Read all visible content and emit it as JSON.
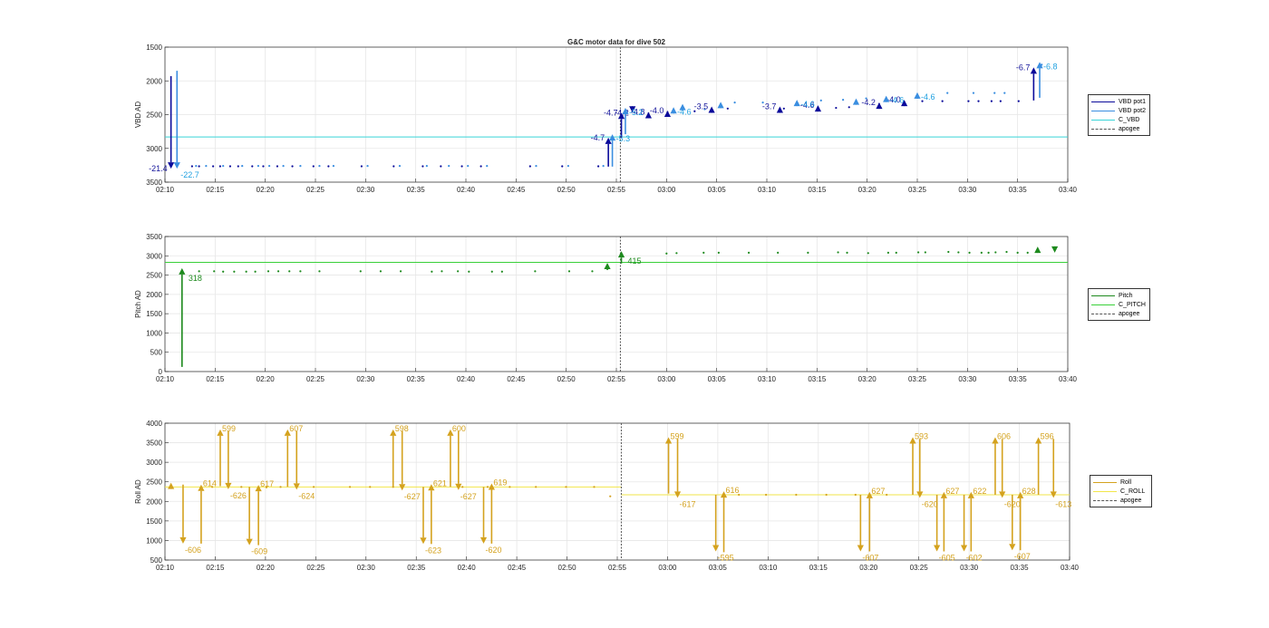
{
  "title": "G&C motor data for dive 502",
  "colors": {
    "vbd_pot1": "#0a0a9a",
    "vbd_pot2": "#3a8ee0",
    "c_vbd": "#39d4d8",
    "vbd_label1": "#14149a",
    "vbd_label2": "#1fa0e0",
    "pitch": "#1e8a1e",
    "c_pitch": "#3ad03a",
    "roll": "#d4a21e",
    "c_roll": "#f2e64a",
    "apogee": "#555555",
    "grid": "#e6e6e6",
    "axis": "#262626"
  },
  "chart_data": [
    {
      "type": "scatter",
      "title": "G&C motor data for dive 502",
      "ylabel": "VBD AD",
      "x_ticks": [
        "02:10",
        "02:15",
        "02:20",
        "02:25",
        "02:30",
        "02:35",
        "02:40",
        "02:45",
        "02:50",
        "02:55",
        "03:00",
        "03:05",
        "03:10",
        "03:15",
        "03:20",
        "03:25",
        "03:30",
        "03:35",
        "03:40"
      ],
      "xlim_minutes": [
        130,
        220
      ],
      "ylim": [
        1500,
        3500
      ],
      "y_reversed": true,
      "y_ticks": [
        "1500",
        "2000",
        "2500",
        "3000",
        "3500"
      ],
      "grid": true,
      "legend": [
        "VBD pot1",
        "VBD pot2",
        "C_VBD",
        "apogee"
      ],
      "legend_position": "right",
      "c_value": 2830,
      "apogee_minutes": 175.4,
      "pot1_points": [
        [
          132.7,
          3265
        ],
        [
          133.4,
          3265
        ],
        [
          134.8,
          3265
        ],
        [
          135.5,
          3265
        ],
        [
          136.5,
          3265
        ],
        [
          137.3,
          3265
        ],
        [
          138.7,
          3265
        ],
        [
          139.8,
          3265
        ],
        [
          141.2,
          3265
        ],
        [
          142.7,
          3265
        ],
        [
          144.8,
          3265
        ],
        [
          146.3,
          3265
        ],
        [
          149.6,
          3265
        ],
        [
          152.8,
          3265
        ],
        [
          155.7,
          3265
        ],
        [
          157.5,
          3265
        ],
        [
          159.6,
          3265
        ],
        [
          161.5,
          3265
        ],
        [
          166.4,
          3265
        ],
        [
          169.6,
          3265
        ],
        [
          173.2,
          3265
        ],
        [
          182.8,
          2450
        ],
        [
          186.1,
          2410
        ],
        [
          191.7,
          2410
        ],
        [
          196.9,
          2400
        ],
        [
          198.2,
          2390
        ],
        [
          205.5,
          2300
        ],
        [
          207.5,
          2300
        ],
        [
          210.1,
          2300
        ],
        [
          211.1,
          2300
        ],
        [
          212.4,
          2300
        ],
        [
          213.3,
          2300
        ],
        [
          215.1,
          2300
        ]
      ],
      "pot2_points": [
        [
          133.1,
          3260
        ],
        [
          134.1,
          3260
        ],
        [
          135.8,
          3260
        ],
        [
          137.7,
          3260
        ],
        [
          139.3,
          3260
        ],
        [
          140.4,
          3260
        ],
        [
          141.8,
          3260
        ],
        [
          143.5,
          3260
        ],
        [
          145.4,
          3260
        ],
        [
          146.8,
          3260
        ],
        [
          150.2,
          3260
        ],
        [
          153.4,
          3260
        ],
        [
          156.1,
          3260
        ],
        [
          158.3,
          3260
        ],
        [
          160.2,
          3260
        ],
        [
          162.1,
          3260
        ],
        [
          167,
          3260
        ],
        [
          170.2,
          3260
        ],
        [
          173.7,
          3260
        ],
        [
          183.8,
          2420
        ],
        [
          186.8,
          2320
        ],
        [
          189.6,
          2320
        ],
        [
          195.4,
          2290
        ],
        [
          197.6,
          2280
        ],
        [
          199.9,
          2260
        ],
        [
          208,
          2180
        ],
        [
          210.6,
          2180
        ],
        [
          212.7,
          2180
        ],
        [
          213.7,
          2180
        ],
        [
          217.4,
          1760
        ]
      ],
      "pot1_moves": [
        {
          "t": 130.6,
          "y0": 1930,
          "y1": 3300,
          "label": "-21.4"
        },
        {
          "t": 174.2,
          "y0": 3270,
          "y1": 2840,
          "label": "-4.7"
        },
        {
          "t": 175.5,
          "y0": 2840,
          "y1": 2470,
          "label": "-4.7"
        },
        {
          "t": 176.6,
          "y0": 2470,
          "y1": 2470,
          "label": "-4.2"
        },
        {
          "t": 178.2,
          "y0": 2470,
          "y1": 2460,
          "label": "-4.8"
        },
        {
          "t": 180.1,
          "y0": 2450,
          "y1": 2440,
          "label": "-4.0"
        },
        {
          "t": 184.5,
          "y0": 2400,
          "y1": 2380,
          "label": "-3.5"
        },
        {
          "t": 191.3,
          "y0": 2400,
          "y1": 2380,
          "label": "-3.7"
        },
        {
          "t": 195.1,
          "y0": 2380,
          "y1": 2360,
          "label": "-4.6"
        },
        {
          "t": 201.2,
          "y0": 2330,
          "y1": 2320,
          "label": "-4.2"
        },
        {
          "t": 203.7,
          "y0": 2300,
          "y1": 2280,
          "label": "-4.0"
        },
        {
          "t": 216.6,
          "y0": 2290,
          "y1": 1800,
          "label": "-6.7"
        }
      ],
      "pot2_moves": [
        {
          "t": 131.2,
          "y0": 1850,
          "y1": 3300,
          "label": "-22.7"
        },
        {
          "t": 174.6,
          "y0": 3270,
          "y1": 2790,
          "label": "-5.3"
        },
        {
          "t": 175.9,
          "y0": 2790,
          "y1": 2400,
          "label": "-5.2"
        },
        {
          "t": 180.7,
          "y0": 2420,
          "y1": 2390,
          "label": "-4.6"
        },
        {
          "t": 181.6,
          "y0": 2400,
          "y1": 2340,
          "label": ""
        },
        {
          "t": 185.4,
          "y0": 2380,
          "y1": 2310,
          "label": ""
        },
        {
          "t": 193,
          "y0": 2320,
          "y1": 2280,
          "label": "-4.6"
        },
        {
          "t": 198.9,
          "y0": 2310,
          "y1": 2260,
          "label": ""
        },
        {
          "t": 201.9,
          "y0": 2270,
          "y1": 2220,
          "label": "-4.6"
        },
        {
          "t": 205,
          "y0": 2240,
          "y1": 2170,
          "label": "-4.6"
        },
        {
          "t": 217.2,
          "y0": 2250,
          "y1": 1720,
          "label": "-6.8"
        }
      ]
    },
    {
      "type": "scatter",
      "ylabel": "Pitch AD",
      "x_ticks": [
        "02:10",
        "02:15",
        "02:20",
        "02:25",
        "02:30",
        "02:35",
        "02:40",
        "02:45",
        "02:50",
        "02:55",
        "03:00",
        "03:05",
        "03:10",
        "03:15",
        "03:20",
        "03:25",
        "03:30",
        "03:35",
        "03:40"
      ],
      "xlim_minutes": [
        130,
        220
      ],
      "ylim": [
        0,
        3500
      ],
      "y_ticks": [
        "0",
        "500",
        "1000",
        "1500",
        "2000",
        "2500",
        "3000",
        "3500"
      ],
      "grid": true,
      "legend": [
        "Pitch",
        "C_PITCH",
        "apogee"
      ],
      "legend_position": "right",
      "c_value": 2830,
      "apogee_minutes": 175.4,
      "points": [
        [
          133.4,
          2600
        ],
        [
          134.9,
          2600
        ],
        [
          135.8,
          2590
        ],
        [
          136.9,
          2590
        ],
        [
          138.1,
          2590
        ],
        [
          139,
          2590
        ],
        [
          140.3,
          2600
        ],
        [
          141.3,
          2600
        ],
        [
          142.4,
          2600
        ],
        [
          143.5,
          2600
        ],
        [
          145.4,
          2600
        ],
        [
          149.5,
          2600
        ],
        [
          151.5,
          2600
        ],
        [
          153.5,
          2600
        ],
        [
          156.6,
          2590
        ],
        [
          157.6,
          2600
        ],
        [
          159.2,
          2600
        ],
        [
          160.3,
          2590
        ],
        [
          162.6,
          2590
        ],
        [
          163.6,
          2590
        ],
        [
          166.9,
          2600
        ],
        [
          170.3,
          2600
        ],
        [
          172.6,
          2600
        ],
        [
          180,
          3060
        ],
        [
          181,
          3070
        ],
        [
          183.7,
          3080
        ],
        [
          185.2,
          3080
        ],
        [
          188.2,
          3080
        ],
        [
          191.1,
          3080
        ],
        [
          194.1,
          3080
        ],
        [
          197.1,
          3090
        ],
        [
          198,
          3080
        ],
        [
          200.1,
          3070
        ],
        [
          202.1,
          3080
        ],
        [
          202.9,
          3080
        ],
        [
          205.1,
          3090
        ],
        [
          205.8,
          3090
        ],
        [
          208.1,
          3100
        ],
        [
          209.1,
          3090
        ],
        [
          210.2,
          3080
        ],
        [
          211.4,
          3080
        ],
        [
          212.1,
          3080
        ],
        [
          212.8,
          3090
        ],
        [
          213.9,
          3100
        ],
        [
          215,
          3080
        ],
        [
          216,
          3080
        ]
      ],
      "moves": [
        {
          "t": 131.7,
          "y0": 120,
          "y1": 2680,
          "label": "318"
        },
        {
          "t": 174.1,
          "y0": 2630,
          "y1": 2820,
          "label": ""
        },
        {
          "t": 175.5,
          "y0": 2800,
          "y1": 3120,
          "label": "415"
        },
        {
          "t": 217,
          "y0": 3140,
          "y1": 3240,
          "label": ""
        },
        {
          "t": 218.7,
          "y0": 3190,
          "y1": 3080,
          "label": ""
        }
      ]
    },
    {
      "type": "scatter",
      "ylabel": "Roll AD",
      "x_ticks": [
        "02:10",
        "02:15",
        "02:20",
        "02:25",
        "02:30",
        "02:35",
        "02:40",
        "02:45",
        "02:50",
        "02:55",
        "03:00",
        "03:05",
        "03:10",
        "03:15",
        "03:20",
        "03:25",
        "03:30",
        "03:35",
        "03:40"
      ],
      "xlim_minutes": [
        130,
        220
      ],
      "ylim": [
        500,
        4000
      ],
      "y_ticks": [
        "500",
        "1000",
        "1500",
        "2000",
        "2500",
        "3000",
        "3500",
        "4000"
      ],
      "grid": true,
      "legend": [
        "Roll",
        "C_ROLL",
        "apogee"
      ],
      "legend_position": "right",
      "c_segments": [
        {
          "t0": 130,
          "t1": 175.4,
          "y": 2370
        },
        {
          "t0": 175.4,
          "t1": 220,
          "y": 2170
        }
      ],
      "apogee_minutes": 175.4,
      "points": [
        [
          134.7,
          2370
        ],
        [
          137.6,
          2370
        ],
        [
          140.1,
          2360
        ],
        [
          141.5,
          2370
        ],
        [
          144.8,
          2370
        ],
        [
          148.4,
          2370
        ],
        [
          150.4,
          2370
        ],
        [
          152.7,
          2370
        ],
        [
          159.6,
          2370
        ],
        [
          162.1,
          2370
        ],
        [
          164.3,
          2370
        ],
        [
          166.9,
          2370
        ],
        [
          169.9,
          2370
        ],
        [
          172.7,
          2370
        ],
        [
          174.3,
          2130
        ],
        [
          187.1,
          2170
        ],
        [
          189.8,
          2170
        ],
        [
          192.8,
          2170
        ],
        [
          195.8,
          2170
        ],
        [
          198.7,
          2170
        ],
        [
          201.8,
          2170
        ]
      ],
      "moves": [
        {
          "t": 130.6,
          "y0": 2400,
          "y1": 2480,
          "label": ""
        },
        {
          "t": 131.8,
          "y0": 2430,
          "y1": 920,
          "label": "-606"
        },
        {
          "t": 133.6,
          "y0": 920,
          "y1": 2430,
          "label": "614"
        },
        {
          "t": 135.5,
          "y0": 2390,
          "y1": 3840,
          "label": "599"
        },
        {
          "t": 136.3,
          "y0": 3800,
          "y1": 2310,
          "label": "-626"
        },
        {
          "t": 138.4,
          "y0": 2370,
          "y1": 880,
          "label": "-609"
        },
        {
          "t": 139.3,
          "y0": 880,
          "y1": 2420,
          "label": "617"
        },
        {
          "t": 142.2,
          "y0": 2370,
          "y1": 3840,
          "label": "607"
        },
        {
          "t": 143.1,
          "y0": 3800,
          "y1": 2300,
          "label": "-624"
        },
        {
          "t": 152.7,
          "y0": 2370,
          "y1": 3840,
          "label": "598"
        },
        {
          "t": 153.6,
          "y0": 3800,
          "y1": 2280,
          "label": "-627"
        },
        {
          "t": 155.7,
          "y0": 2370,
          "y1": 910,
          "label": "-623"
        },
        {
          "t": 156.5,
          "y0": 910,
          "y1": 2440,
          "label": "621"
        },
        {
          "t": 158.4,
          "y0": 2370,
          "y1": 3840,
          "label": "600"
        },
        {
          "t": 159.2,
          "y0": 3800,
          "y1": 2290,
          "label": "-627"
        },
        {
          "t": 161.7,
          "y0": 2370,
          "y1": 920,
          "label": "-620"
        },
        {
          "t": 162.5,
          "y0": 920,
          "y1": 2460,
          "label": "619"
        },
        {
          "t": 180.1,
          "y0": 2200,
          "y1": 3640,
          "label": "599"
        },
        {
          "t": 181,
          "y0": 3600,
          "y1": 2090,
          "label": "-617"
        },
        {
          "t": 184.8,
          "y0": 2170,
          "y1": 720,
          "label": "-595"
        },
        {
          "t": 185.6,
          "y0": 700,
          "y1": 2260,
          "label": "616"
        },
        {
          "t": 199.2,
          "y0": 2170,
          "y1": 720,
          "label": "-607"
        },
        {
          "t": 200.1,
          "y0": 720,
          "y1": 2240,
          "label": "627"
        },
        {
          "t": 204.4,
          "y0": 2170,
          "y1": 3640,
          "label": "593"
        },
        {
          "t": 205.1,
          "y0": 3600,
          "y1": 2090,
          "label": "-620"
        },
        {
          "t": 206.8,
          "y0": 2170,
          "y1": 720,
          "label": "-605"
        },
        {
          "t": 207.5,
          "y0": 720,
          "y1": 2240,
          "label": "627"
        },
        {
          "t": 209.5,
          "y0": 2170,
          "y1": 720,
          "label": "-602"
        },
        {
          "t": 210.2,
          "y0": 720,
          "y1": 2240,
          "label": "622"
        },
        {
          "t": 212.6,
          "y0": 2170,
          "y1": 3640,
          "label": "606"
        },
        {
          "t": 213.3,
          "y0": 3600,
          "y1": 2090,
          "label": "-620"
        },
        {
          "t": 214.3,
          "y0": 2170,
          "y1": 750,
          "label": "-607"
        },
        {
          "t": 215.1,
          "y0": 750,
          "y1": 2240,
          "label": "628"
        },
        {
          "t": 216.9,
          "y0": 2170,
          "y1": 3640,
          "label": "596"
        },
        {
          "t": 218.4,
          "y0": 3600,
          "y1": 2090,
          "label": "-613"
        }
      ]
    }
  ]
}
